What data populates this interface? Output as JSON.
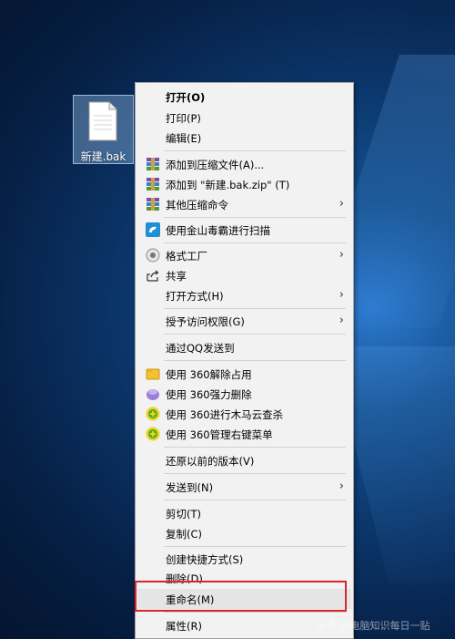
{
  "desktop_icon": {
    "label": "新建.bak"
  },
  "context_menu": {
    "items": [
      {
        "label": "打开(O)"
      },
      {
        "label": "打印(P)"
      },
      {
        "label": "编辑(E)"
      },
      {
        "label": "添加到压缩文件(A)..."
      },
      {
        "label": "添加到 \"新建.bak.zip\" (T)"
      },
      {
        "label": "其他压缩命令"
      },
      {
        "label": "使用金山毒霸进行扫描"
      },
      {
        "label": "格式工厂"
      },
      {
        "label": "共享"
      },
      {
        "label": "打开方式(H)"
      },
      {
        "label": "授予访问权限(G)"
      },
      {
        "label": "通过QQ发送到"
      },
      {
        "label": "使用 360解除占用"
      },
      {
        "label": "使用 360强力删除"
      },
      {
        "label": "使用 360进行木马云查杀"
      },
      {
        "label": "使用 360管理右键菜单"
      },
      {
        "label": "还原以前的版本(V)"
      },
      {
        "label": "发送到(N)"
      },
      {
        "label": "剪切(T)"
      },
      {
        "label": "复制(C)"
      },
      {
        "label": "创建快捷方式(S)"
      },
      {
        "label": "删除(D)"
      },
      {
        "label": "重命名(M)"
      },
      {
        "label": "属性(R)"
      }
    ],
    "highlighted_item": "重命名(M)",
    "submenu_arrow": "›"
  },
  "watermark": "头条 @电脑知识每日一贴",
  "colors": {
    "highlight_box": "#d9262a",
    "menu_bg": "#f2f2f2"
  }
}
